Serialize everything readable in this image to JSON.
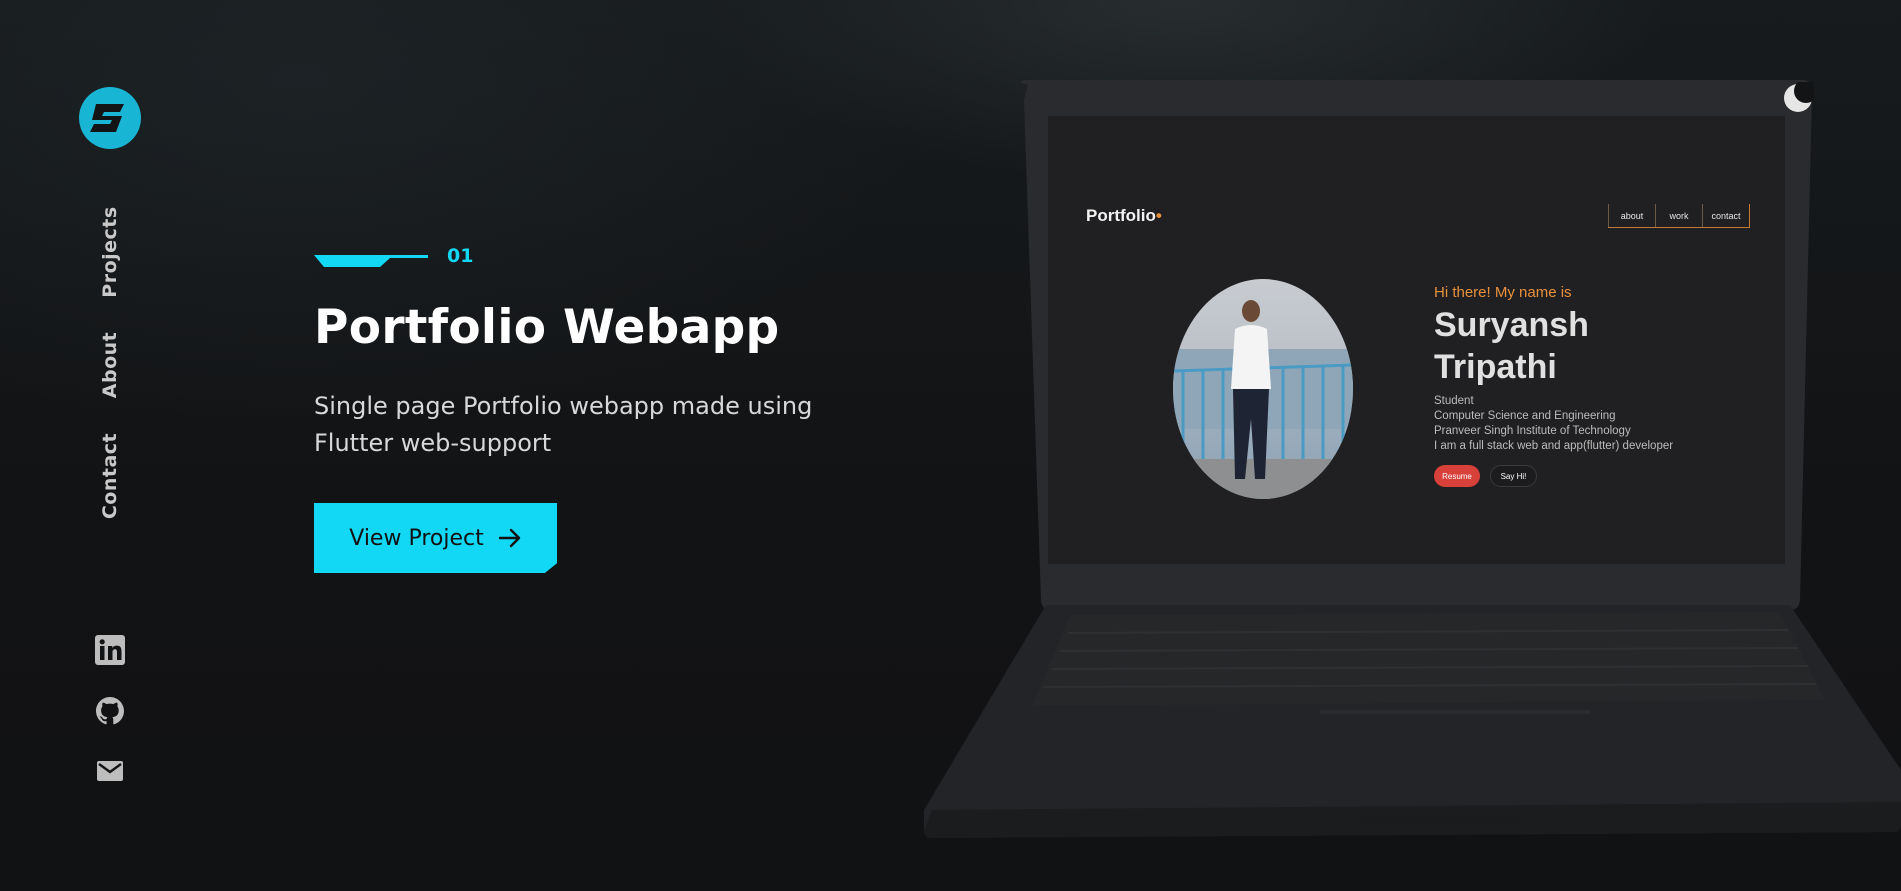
{
  "sidebar": {
    "logo": "s-logo",
    "nav": [
      "Projects",
      "About",
      "Contact"
    ],
    "socials": [
      "linkedin-icon",
      "github-icon",
      "mail-icon"
    ]
  },
  "hero": {
    "index": "01",
    "title": "Portfolio Webapp",
    "description": "Single page Portfolio webapp made using Flutter web-support",
    "cta_label": "View Project",
    "cta_icon": "arrow-right-icon"
  },
  "theme_toggle_icon": "moon-icon",
  "preview": {
    "brand": "Portfolio",
    "brand_dot": "•",
    "nav": [
      "about",
      "work",
      "contact"
    ],
    "greeting": "Hi there! My name is",
    "name_line1": "Suryansh",
    "name_line2": "Tripathi",
    "lines": [
      "Student",
      "Computer Science and Engineering",
      "Pranveer Singh Institute of Technology",
      "I am a full stack web and app(flutter) developer"
    ],
    "resume_label": "Resume",
    "sayhi_label": "Say Hi!"
  },
  "colors": {
    "accent": "#12d8f6",
    "background": "#131416",
    "preview_accent": "#e8903a",
    "resume_red": "#d8403a"
  }
}
